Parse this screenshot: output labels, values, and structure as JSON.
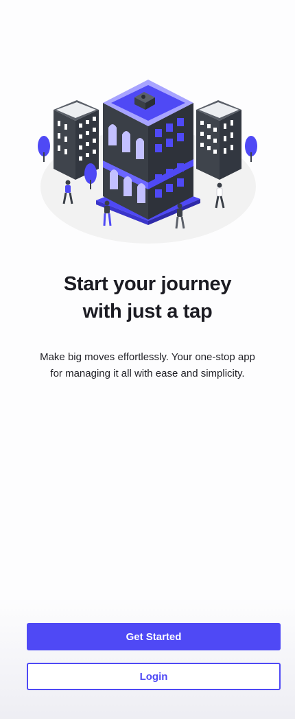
{
  "onboarding": {
    "headline_line1": "Start your journey",
    "headline_line2": "with just a tap",
    "subtitle_line1": "Make big moves effortlessly. Your one-stop app",
    "subtitle_line2": "for managing it all with ease and simplicity.",
    "illustration_icon": "city-buildings-illustration"
  },
  "actions": {
    "get_started_label": "Get Started",
    "login_label": "Login"
  },
  "colors": {
    "accent": "#4f49f5",
    "building_dark": "#3a3f47",
    "text": "#1b1b22",
    "ground": "#f2f2f2"
  }
}
